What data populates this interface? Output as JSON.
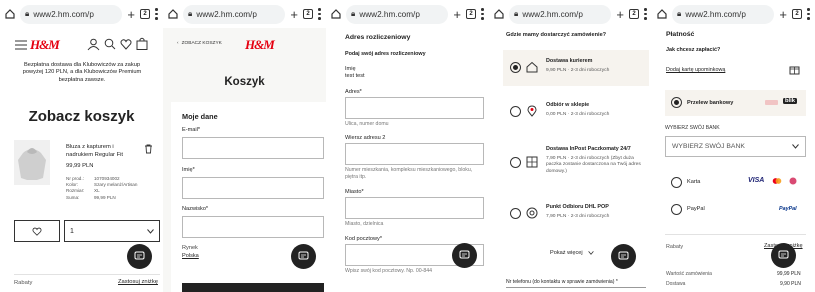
{
  "browser": {
    "url": "www2.hm.com/p",
    "tab_count": "2"
  },
  "brand": {
    "logo": "H&M",
    "accent": "#e50010"
  },
  "p1": {
    "promo": "Bezpłatna dostawa dla Klubowiczów za zakup powyżej 120 PLN, a dla Klubowiczów Premium bezpłatna zawsze.",
    "title": "Zobacz koszyk",
    "product_name": "Bluza z kapturem i nadrukiem Regular Fit",
    "product_price": "99,99 PLN",
    "details": [
      {
        "k": "Nr prod.:",
        "v": "1070934002"
      },
      {
        "k": "Kolor:",
        "v": "Szary melanż/Artisan"
      },
      {
        "k": "Rozmiar:",
        "v": "XL"
      },
      {
        "k": "Suma:",
        "v": "99,99 PLN"
      }
    ],
    "qty": "1",
    "rabaty": "Rabaty",
    "zastosuj": "Zastosuj zniżkę"
  },
  "p2": {
    "back": "ZOBACZ KOSZYK",
    "title": "Koszyk",
    "section": "Moje dane",
    "email_label": "E-mail*",
    "name_label": "Imię*",
    "surname_label": "Nazwisko*",
    "market": "Rynek",
    "country": "Polska"
  },
  "p3": {
    "title": "Adres rozliczeniowy",
    "subtitle": "Podaj swój adres rozliczeniowy",
    "name_label": "Imię",
    "name_value": "test test",
    "address_label": "Adres*",
    "address_hint": "Ulica, numer domu",
    "line2_label": "Wiersz adresu 2",
    "line2_hint": "Numer mieszkania, kompleksu mieszkaniowego, bloku, piętra itp.",
    "city_label": "Miasto*",
    "city_hint": "Miasto, dzielnica",
    "zip_label": "Kod pocztowy*",
    "zip_hint": "Wpisz swój kod pocztowy. Np. 00-844"
  },
  "p4": {
    "title": "Gdzie mamy dostarczyć zamówienie?",
    "options": [
      {
        "name": "Dostawa kurierem",
        "detail": "9,90 PLN · 2-3 dni roboczych",
        "selected": true
      },
      {
        "name": "Odbiór w sklepie",
        "detail": "0,00 PLN · 2-3 dni roboczych",
        "selected": false
      },
      {
        "name": "Dostawa InPost Paczkomaty 24/7",
        "detail": "7,90 PLN · 2-3 dni roboczych (Zbyt duża paczka zostanie dostarczona na Twój adres domowy.)",
        "selected": false
      },
      {
        "name": "Punkt Odbioru DHL POP",
        "detail": "7,90 PLN · 2-3 dni roboczych",
        "selected": false
      }
    ],
    "show_more": "Pokaż więcej",
    "phone_label": "Nr telefonu (do kontaktu w sprawie zamówienia) *"
  },
  "p5": {
    "title": "Płatność",
    "question": "Jak chcesz zapłacić?",
    "gift_card": "Dodaj kartę upominkową",
    "bank_transfer": "Przelew bankowy",
    "blik": "blik",
    "bank_heading": "WYBIERZ SWÓJ BANK",
    "bank_select": "WYBIERZ SWÓJ BANK",
    "card": "Karta",
    "visa": "VISA",
    "paypal": "PayPal",
    "paypal_logo": "PayPal",
    "rabaty": "Rabaty",
    "zastosuj": "Zastosuj zniżkę",
    "order_value_label": "Wartość zamówienia",
    "order_value": "99,99 PLN",
    "delivery_label": "Dostawa",
    "delivery_value": "9,90 PLN"
  }
}
